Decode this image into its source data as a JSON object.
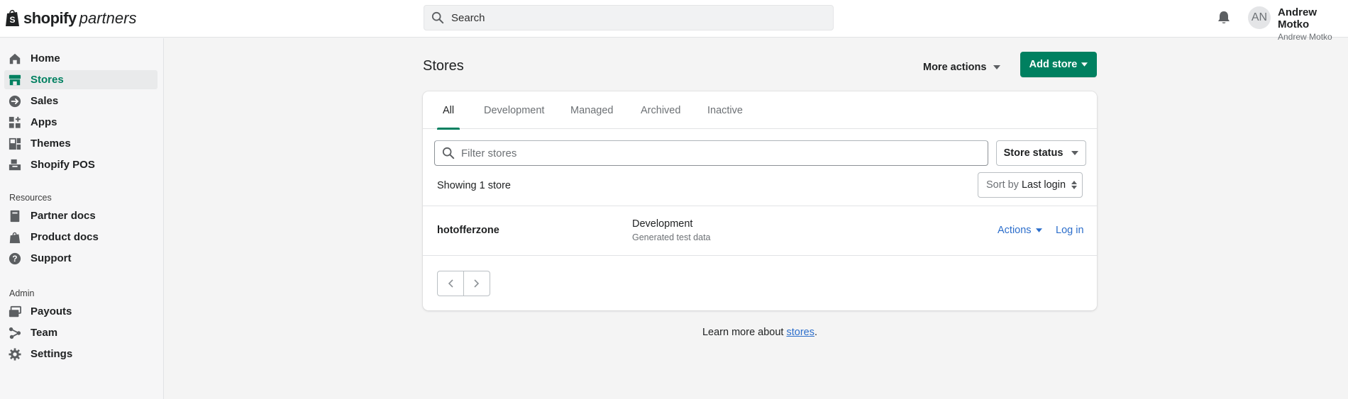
{
  "topbar": {
    "logo_word": "shopify",
    "logo_suffix": "partners",
    "search_placeholder": "Search",
    "user": {
      "initials": "AN",
      "name": "Andrew Motko",
      "subname": "Andrew Motko"
    }
  },
  "sidebar": {
    "items": [
      {
        "label": "Home",
        "icon": "home-icon"
      },
      {
        "label": "Stores",
        "icon": "store-icon",
        "active": true
      },
      {
        "label": "Sales",
        "icon": "sales-icon"
      },
      {
        "label": "Apps",
        "icon": "apps-icon"
      },
      {
        "label": "Themes",
        "icon": "themes-icon"
      },
      {
        "label": "Shopify POS",
        "icon": "pos-icon"
      }
    ],
    "resources_title": "Resources",
    "resources": [
      {
        "label": "Partner docs",
        "icon": "partner-docs-icon"
      },
      {
        "label": "Product docs",
        "icon": "product-docs-icon"
      },
      {
        "label": "Support",
        "icon": "support-icon"
      }
    ],
    "admin_title": "Admin",
    "admin": [
      {
        "label": "Payouts",
        "icon": "payouts-icon"
      },
      {
        "label": "Team",
        "icon": "team-icon"
      },
      {
        "label": "Settings",
        "icon": "settings-icon"
      }
    ]
  },
  "page": {
    "title": "Stores",
    "more_actions": "More actions",
    "add_store": "Add store"
  },
  "tabs": [
    {
      "label": "All",
      "active": true
    },
    {
      "label": "Development"
    },
    {
      "label": "Managed"
    },
    {
      "label": "Archived"
    },
    {
      "label": "Inactive"
    }
  ],
  "filter": {
    "placeholder": "Filter stores",
    "status_button": "Store status",
    "showing": "Showing 1 store",
    "sort_label": "Sort by",
    "sort_value": "Last login"
  },
  "stores": [
    {
      "name": "hotofferzone",
      "type": "Development",
      "subtitle": "Generated test data",
      "actions": "Actions",
      "login": "Log in"
    }
  ],
  "footer": {
    "prefix": "Learn more about ",
    "link": "stores",
    "suffix": "."
  },
  "colors": {
    "accent": "#008060",
    "link": "#2c6ecb"
  }
}
